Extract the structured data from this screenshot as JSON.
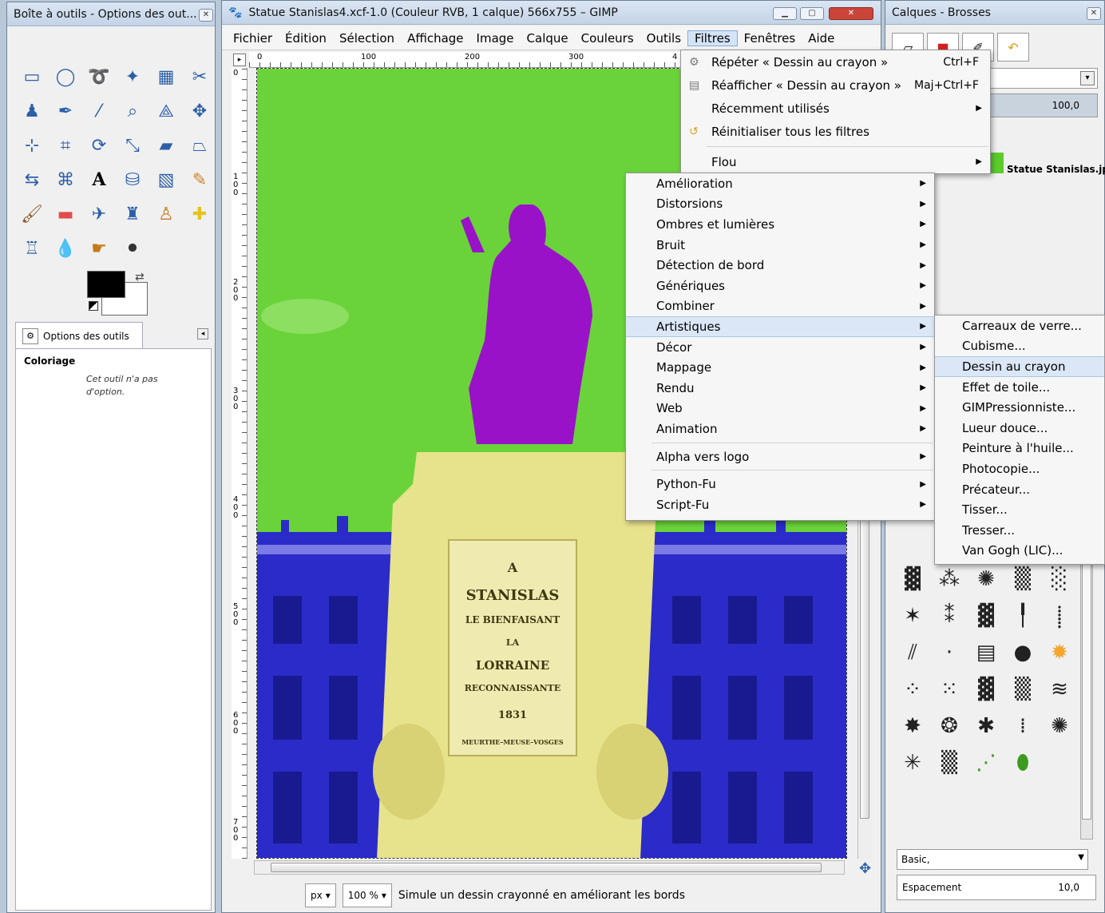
{
  "toolbox": {
    "title": "Boîte à outils - Options des out...",
    "tool_icons": [
      "rect-select",
      "ellipse-select",
      "free-select",
      "fuzzy-select",
      "color-select",
      "scissors",
      "foreground-select",
      "paths",
      "color-picker",
      "zoom",
      "measure",
      "move",
      "align",
      "crop",
      "rotate",
      "scale",
      "shear",
      "perspective",
      "flip",
      "cage",
      "text",
      "bucket-fill",
      "blend",
      "pencil",
      "paintbrush",
      "eraser",
      "airbrush",
      "ink",
      "clone",
      "heal",
      "perspective-clone",
      "blur",
      "smudge",
      "dodge"
    ],
    "tab_label": "Options des outils",
    "options_title": "Coloriage",
    "options_note": "Cet outil n'a pas d'option."
  },
  "image_window": {
    "title": "Statue Stanislas4.xcf-1.0 (Couleur RVB, 1 calque) 566x755 – GIMP",
    "menus": [
      "Fichier",
      "Édition",
      "Sélection",
      "Affichage",
      "Image",
      "Calque",
      "Couleurs",
      "Outils",
      "Filtres",
      "Fenêtres",
      "Aide"
    ],
    "ruler_h": [
      "0",
      "100",
      "200",
      "300",
      "4"
    ],
    "ruler_v": [
      "0",
      "100",
      "200",
      "300",
      "400",
      "500",
      "600",
      "700"
    ],
    "plaque": [
      "A",
      "STANISLAS",
      "LE BIENFAISANT",
      "LA",
      "LORRAINE",
      "RECONNAISSANTE",
      "1831",
      "MEURTHE–MEUSE–VOSGES"
    ],
    "unit": "px",
    "zoom": "100 %",
    "status": "Simule un dessin crayonné en améliorant les bords"
  },
  "filters_menu": {
    "items": [
      {
        "label": "Répéter « Dessin au crayon »",
        "accel": "Ctrl+F"
      },
      {
        "label": "Réafficher « Dessin au crayon »",
        "accel": "Maj+Ctrl+F"
      },
      {
        "label": "Récemment utilisés",
        "accel": ""
      },
      {
        "label": "Réinitialiser tous les filtres",
        "accel": ""
      },
      {
        "label": "Flou",
        "accel": ""
      }
    ]
  },
  "filters_sub": {
    "items": [
      "Amélioration",
      "Distorsions",
      "Ombres et lumières",
      "Bruit",
      "Détection de bord",
      "Génériques",
      "Combiner",
      "Artistiques",
      "Décor",
      "Mappage",
      "Rendu",
      "Web",
      "Animation",
      "Alpha vers logo",
      "Python-Fu",
      "Script-Fu"
    ]
  },
  "artistic_sub": {
    "items": [
      "Carreaux de verre...",
      "Cubisme...",
      "Dessin au crayon",
      "Effet de toile...",
      "GIMPressionniste...",
      "Lueur douce...",
      "Peinture à l'huile...",
      "Photocopie...",
      "Précateur...",
      "Tisser...",
      "Tresser...",
      "Van Gogh (LIC)..."
    ]
  },
  "dock": {
    "title": "Calques - Brosses",
    "opacity": "100,0",
    "layer_name": "Statue Stanislas.jp",
    "brush_set": "Basic,",
    "spacing_label": "Espacement",
    "spacing_value": "10,0"
  },
  "colors": {
    "sky": "#6ad33a",
    "building": "#2b2bc9",
    "statue": "#9a12c8",
    "pedestal": "#e7e28c"
  }
}
